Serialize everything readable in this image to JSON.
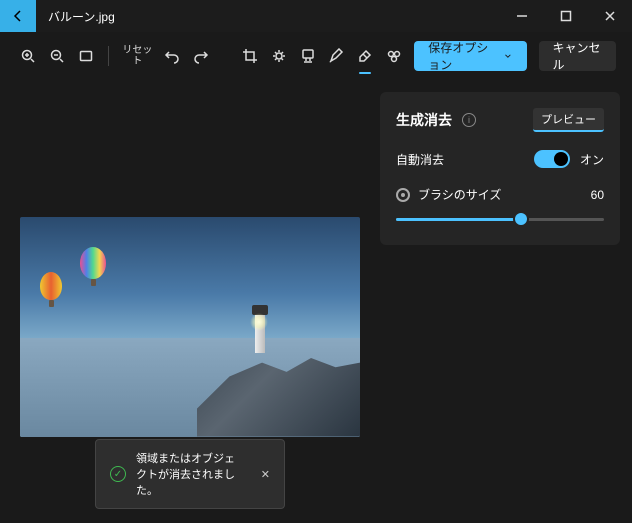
{
  "titlebar": {
    "filename": "バルーン.jpg"
  },
  "toolbar": {
    "reset_label": "リセット",
    "save_label": "保存オプション",
    "cancel_label": "キャンセル"
  },
  "panel": {
    "title": "生成消去",
    "preview_label": "プレビュー",
    "auto_erase_label": "自動消去",
    "auto_erase_on": "オン",
    "brush_size_label": "ブラシのサイズ",
    "brush_size_value": "60"
  },
  "toast": {
    "message": "領域またはオブジェクトが消去されました。"
  }
}
